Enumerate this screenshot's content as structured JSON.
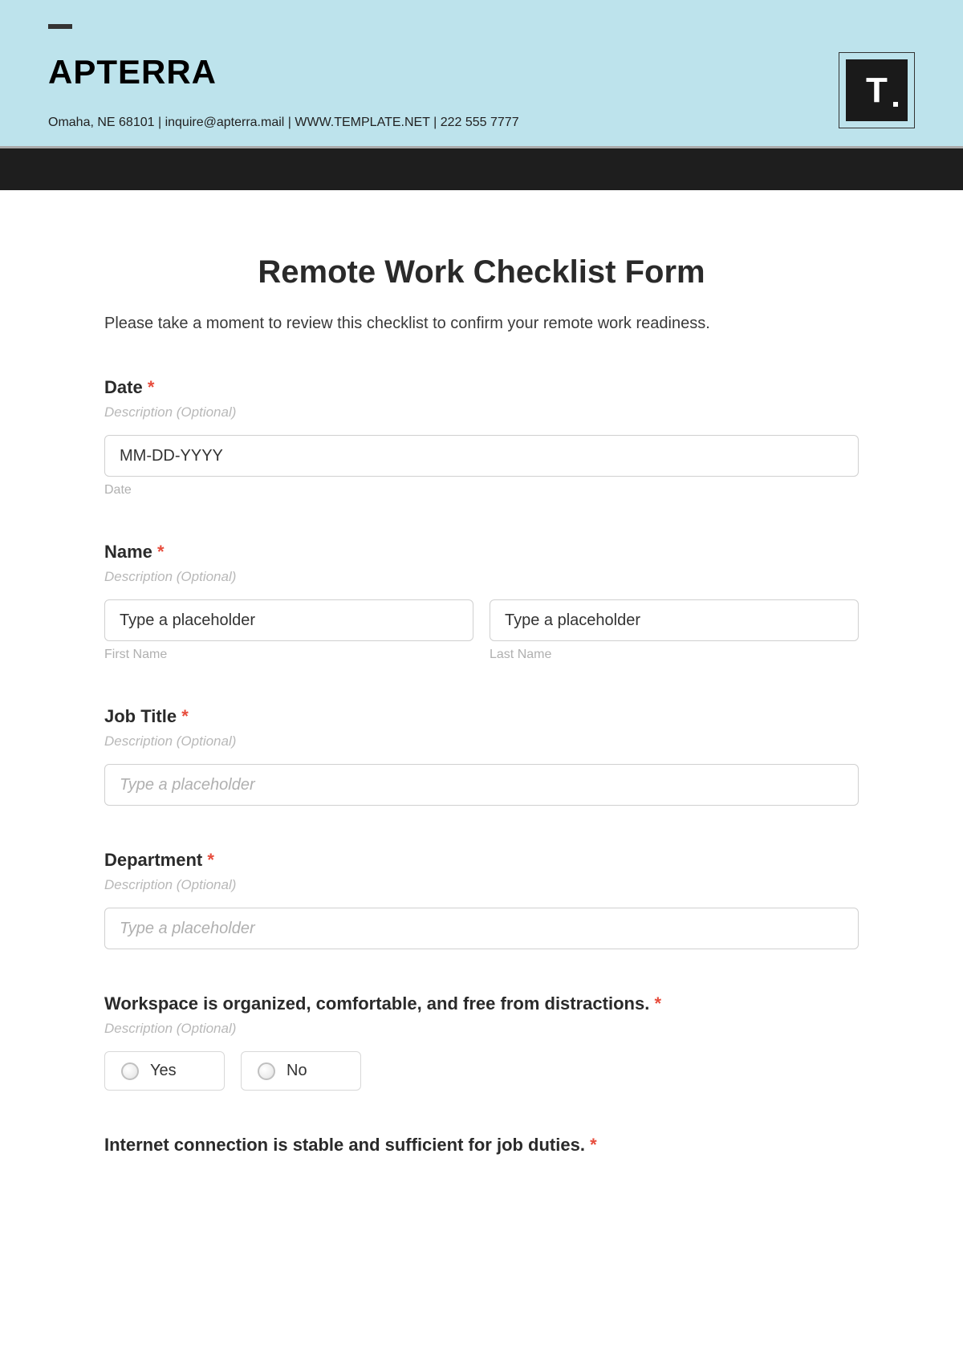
{
  "header": {
    "brand": "APTERRA",
    "contact": "Omaha, NE 68101 | inquire@apterra.mail | WWW.TEMPLATE.NET | 222 555 7777",
    "logo_letter": "T"
  },
  "form": {
    "title": "Remote Work Checklist Form",
    "description": "Please take a moment to review this checklist to confirm your remote work readiness."
  },
  "fields": {
    "date": {
      "label": "Date",
      "subdesc": "Description (Optional)",
      "placeholder": "MM-DD-YYYY",
      "sublabel": "Date"
    },
    "name": {
      "label": "Name",
      "subdesc": "Description (Optional)",
      "first_placeholder": "Type a placeholder",
      "first_sublabel": "First Name",
      "last_placeholder": "Type a placeholder",
      "last_sublabel": "Last Name"
    },
    "jobtitle": {
      "label": "Job Title",
      "subdesc": "Description (Optional)",
      "placeholder": "Type a placeholder"
    },
    "department": {
      "label": "Department",
      "subdesc": "Description (Optional)",
      "placeholder": "Type a placeholder"
    },
    "workspace": {
      "label": "Workspace is organized, comfortable, and free from distractions.",
      "subdesc": "Description (Optional)",
      "option_yes": "Yes",
      "option_no": "No"
    },
    "internet": {
      "label": "Internet connection is stable and sufficient for job duties."
    }
  },
  "required_mark": "*"
}
